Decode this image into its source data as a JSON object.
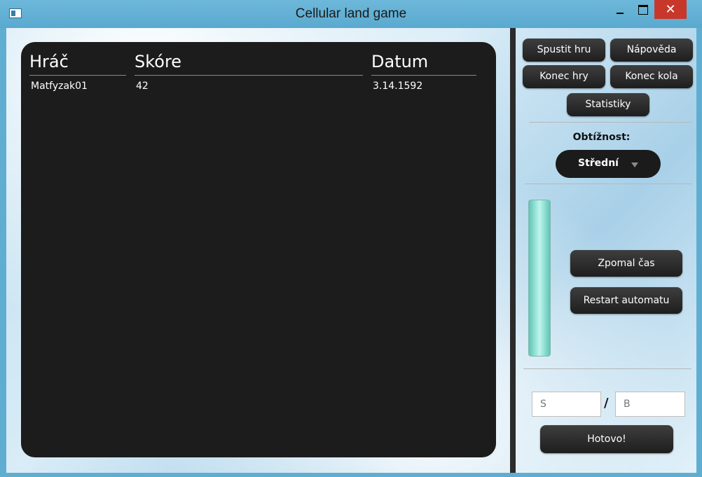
{
  "window": {
    "title": "Cellular land game"
  },
  "table": {
    "columns": [
      "Hráč",
      "Skóre",
      "Datum"
    ],
    "rows": [
      [
        "Matfyzak01",
        "42",
        "3.14.1592"
      ]
    ]
  },
  "controls": {
    "start_label": "Spustit hru",
    "help_label": "Nápověda",
    "end_game_label": "Konec hry",
    "end_round_label": "Konec kola",
    "stats_label": "Statistiky",
    "difficulty_label": "Obtížnost:",
    "difficulty_value": "Střední",
    "slow_time_label": "Zpomal čas",
    "restart_label": "Restart automatu",
    "input_s_placeholder": "S",
    "input_b_placeholder": "B",
    "separator": "/",
    "done_label": "Hotovo!"
  },
  "slider": {
    "level": 1.0
  },
  "colors": {
    "titlebar": "#5faed2",
    "close": "#c7382b",
    "panel": "#1c1c1c",
    "slider": "#8ee3d6"
  }
}
